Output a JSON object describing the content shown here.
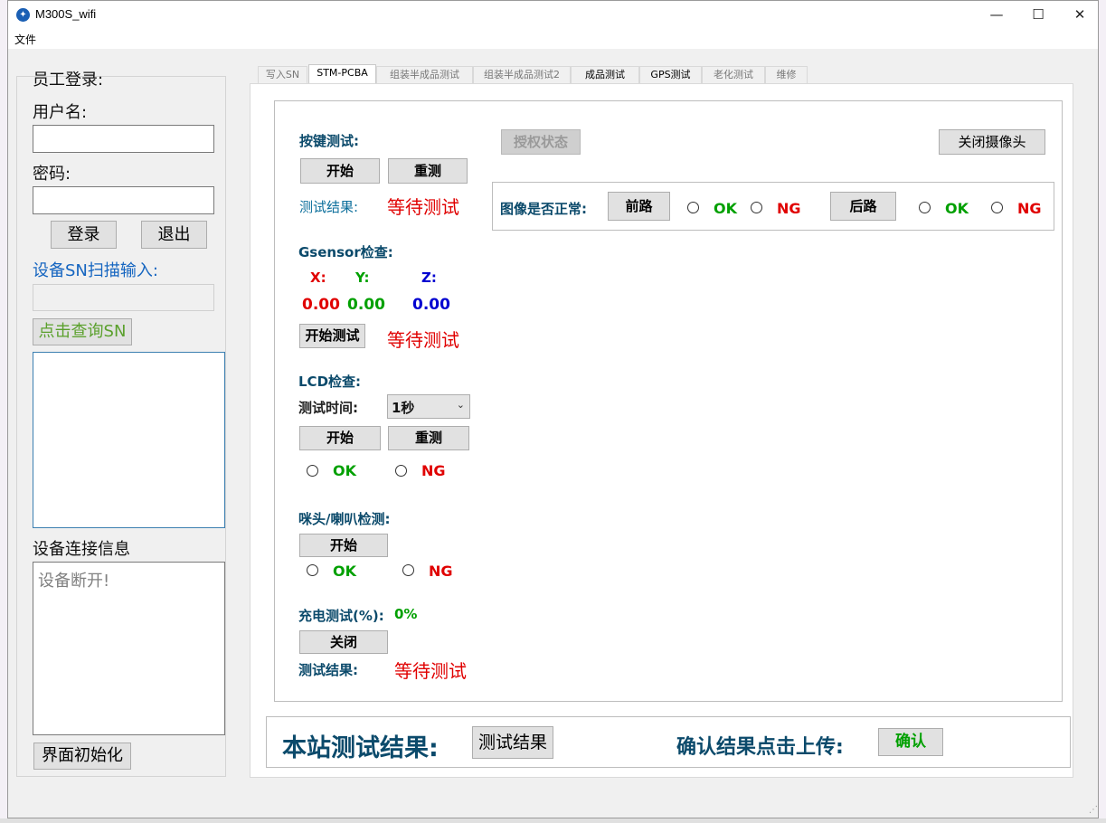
{
  "window": {
    "title": "M300S_wifi",
    "menu": [
      "文件"
    ]
  },
  "login": {
    "heading": "员工登录:",
    "username_label": "用户名:",
    "password_label": "密码:",
    "login_button": "登录",
    "logout_button": "退出",
    "sn_label": "设备SN扫描输入:",
    "query_sn_button": "点击查询SN",
    "conn_label": "设备连接信息",
    "conn_text": "设备断开!",
    "reset_button": "界面初始化"
  },
  "tabs": [
    "写入SN",
    "STM-PCBA",
    "组装半成品测试",
    "组装半成品测试2",
    "成品测试",
    "GPS测试",
    "老化测试",
    "维修"
  ],
  "key_test": {
    "title": "按键测试:",
    "start": "开始",
    "retest": "重测",
    "result_label": "测试结果:",
    "result_value": "等待测试"
  },
  "gsensor": {
    "title": "Gsensor检查:",
    "x_label": "X:",
    "y_label": "Y:",
    "z_label": "Z:",
    "x_value": "0.00",
    "y_value": "0.00",
    "z_value": "0.00",
    "start": "开始测试",
    "status": "等待测试"
  },
  "lcd": {
    "title": "LCD检查:",
    "time_label": "测试时间:",
    "time_value": "1秒",
    "start": "开始",
    "retest": "重测",
    "ok": "OK",
    "ng": "NG"
  },
  "audio": {
    "title": "咪头/喇叭检测:",
    "start": "开始",
    "ok": "OK",
    "ng": "NG"
  },
  "charge": {
    "title": "充电测试(%):",
    "value": "0%",
    "close": "关闭",
    "result_label": "测试结果:",
    "result_value": "等待测试"
  },
  "camera": {
    "auth_button": "授权状态",
    "close_camera": "关闭摄像头",
    "image_label": "图像是否正常:",
    "front": "前路",
    "rear": "后路",
    "ok": "OK",
    "ng": "NG"
  },
  "footer": {
    "station_label": "本站测试结果:",
    "result_button": "测试结果",
    "confirm_label": "确认结果点击上传:",
    "confirm_button": "确认"
  },
  "colors": {
    "red": "#e00000",
    "green": "#00a000",
    "blue_text": "#0b4a6b",
    "navy": "#0000d0",
    "sn_blue": "#1565c0",
    "query_green": "#5aa02c"
  }
}
